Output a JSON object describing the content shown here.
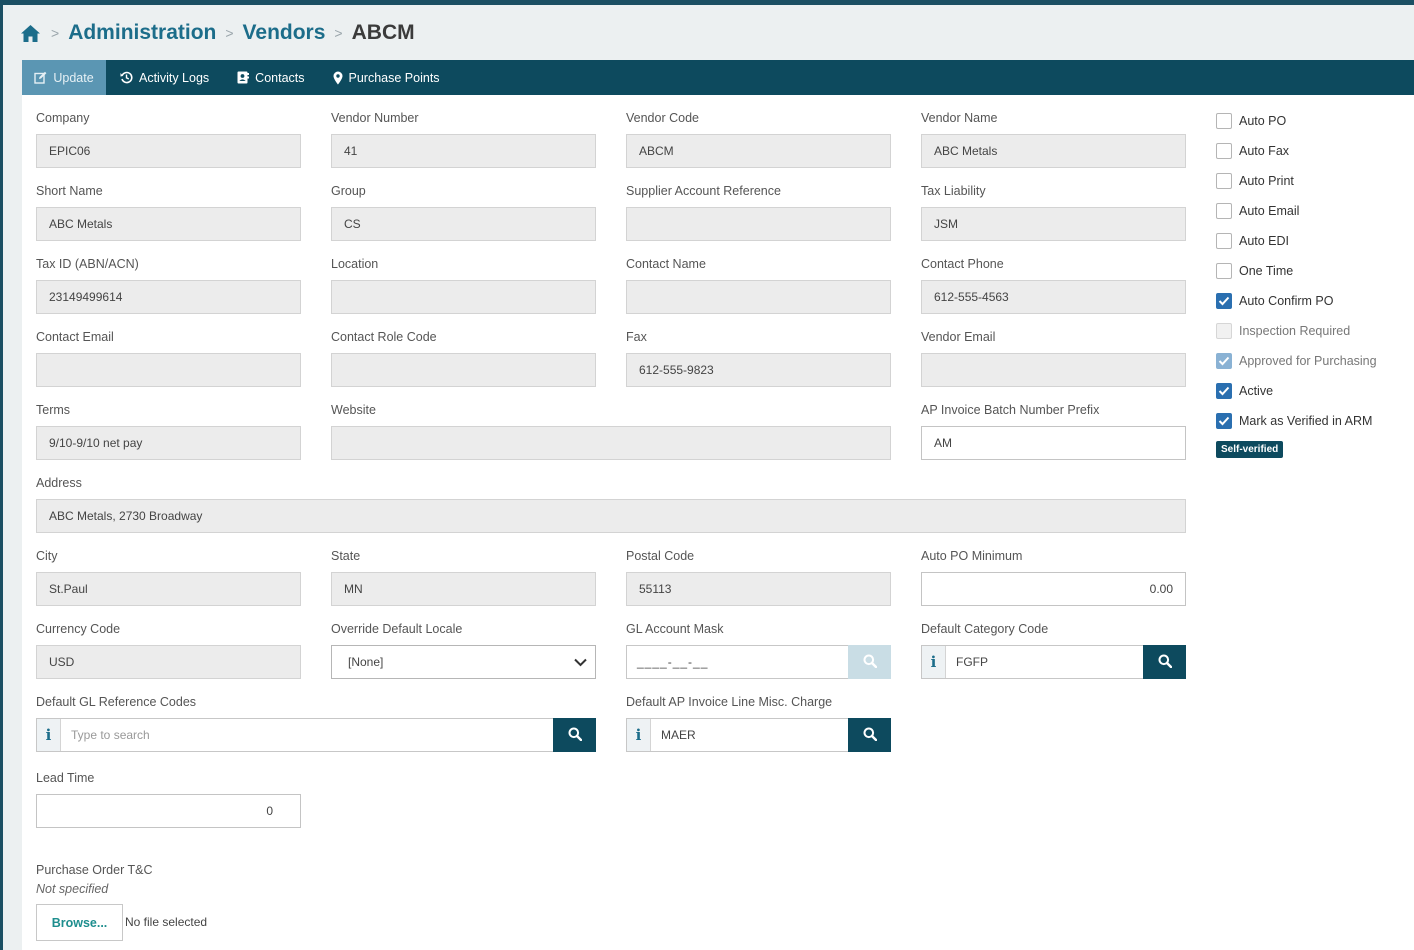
{
  "breadcrumb": {
    "home_icon": "home-icon",
    "items": [
      "Administration",
      "Vendors"
    ],
    "current": "ABCM"
  },
  "tabs": [
    {
      "label": "Update",
      "icon": "edit-icon",
      "active": true
    },
    {
      "label": "Activity Logs",
      "icon": "history-icon"
    },
    {
      "label": "Contacts",
      "icon": "address-card-icon"
    },
    {
      "label": "Purchase Points",
      "icon": "map-marker-icon"
    }
  ],
  "form": {
    "company": {
      "label": "Company",
      "value": "EPIC06"
    },
    "vendor_number": {
      "label": "Vendor Number",
      "value": "41"
    },
    "vendor_code": {
      "label": "Vendor Code",
      "value": "ABCM"
    },
    "vendor_name": {
      "label": "Vendor Name",
      "value": "ABC Metals"
    },
    "short_name": {
      "label": "Short Name",
      "value": "ABC Metals"
    },
    "group": {
      "label": "Group",
      "value": "CS"
    },
    "supplier_account_reference": {
      "label": "Supplier Account Reference",
      "value": ""
    },
    "tax_liability": {
      "label": "Tax Liability",
      "value": "JSM"
    },
    "tax_id": {
      "label": "Tax ID (ABN/ACN)",
      "value": "23149499614"
    },
    "location": {
      "label": "Location",
      "value": ""
    },
    "contact_name": {
      "label": "Contact Name",
      "value": ""
    },
    "contact_phone": {
      "label": "Contact Phone",
      "value": "612-555-4563"
    },
    "contact_email": {
      "label": "Contact Email",
      "value": ""
    },
    "contact_role_code": {
      "label": "Contact Role Code",
      "value": ""
    },
    "fax": {
      "label": "Fax",
      "value": "612-555-9823"
    },
    "vendor_email": {
      "label": "Vendor Email",
      "value": ""
    },
    "terms": {
      "label": "Terms",
      "value": "9/10-9/10 net pay"
    },
    "website": {
      "label": "Website",
      "value": ""
    },
    "ap_invoice_batch_prefix": {
      "label": "AP Invoice Batch Number Prefix",
      "value": "AM"
    },
    "address": {
      "label": "Address",
      "value": "ABC Metals, 2730 Broadway"
    },
    "city": {
      "label": "City",
      "value": "St.Paul"
    },
    "state": {
      "label": "State",
      "value": "MN"
    },
    "postal_code": {
      "label": "Postal Code",
      "value": "55113"
    },
    "auto_po_minimum": {
      "label": "Auto PO Minimum",
      "value": "0.00"
    },
    "currency_code": {
      "label": "Currency Code",
      "value": "USD"
    },
    "override_default_locale": {
      "label": "Override Default Locale",
      "value": "[None]"
    },
    "gl_account_mask": {
      "label": "GL Account Mask",
      "value": "____-__-__"
    },
    "default_category_code": {
      "label": "Default Category Code",
      "value": "FGFP"
    },
    "default_gl_reference_codes": {
      "label": "Default GL Reference Codes",
      "placeholder": "Type to search"
    },
    "default_ap_invoice_line_misc": {
      "label": "Default AP Invoice Line Misc. Charge",
      "value": "MAER"
    },
    "lead_time": {
      "label": "Lead Time",
      "value": "0"
    },
    "po_tc": {
      "label": "Purchase Order T&C",
      "status": "Not specified",
      "browse_label": "Browse...",
      "file_status": "No file selected"
    }
  },
  "checkboxes": [
    {
      "label": "Auto PO",
      "checked": false
    },
    {
      "label": "Auto Fax",
      "checked": false
    },
    {
      "label": "Auto Print",
      "checked": false
    },
    {
      "label": "Auto Email",
      "checked": false
    },
    {
      "label": "Auto EDI",
      "checked": false
    },
    {
      "label": "One Time",
      "checked": false
    },
    {
      "label": "Auto Confirm PO",
      "checked": true
    },
    {
      "label": "Inspection Required",
      "checked": false,
      "disabled": true
    },
    {
      "label": "Approved for Purchasing",
      "checked": true,
      "disabled": true
    },
    {
      "label": "Active",
      "checked": true
    },
    {
      "label": "Mark as Verified in ARM",
      "checked": true
    }
  ],
  "badge": "Self-verified",
  "colors": {
    "brand": "#0d4a5e",
    "active_tab": "#5b96b3",
    "link": "#1c6d8a",
    "checkbox": "#2a6fb0"
  }
}
